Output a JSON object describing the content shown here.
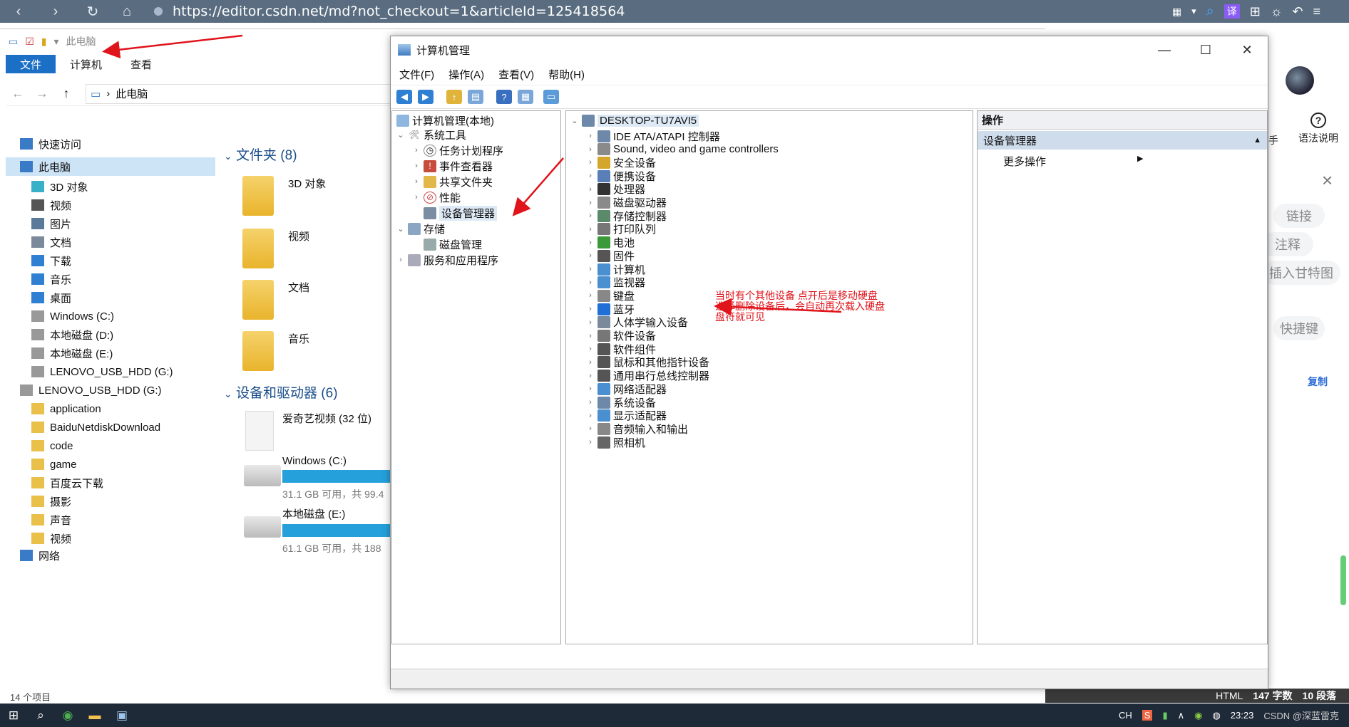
{
  "browser": {
    "url": "https://editor.csdn.net/md?not_checkout=1&articleId=125418564"
  },
  "explorer": {
    "quick_path": "此电脑",
    "tabs": [
      "文件",
      "计算机",
      "查看"
    ],
    "address": "此电脑",
    "nav": [
      {
        "label": "快速访问",
        "icon": "star"
      },
      {
        "label": "此电脑",
        "icon": "pc",
        "selected": true
      },
      {
        "label": "3D 对象",
        "icon": "cube"
      },
      {
        "label": "视频",
        "icon": "film"
      },
      {
        "label": "图片",
        "icon": "picture"
      },
      {
        "label": "文档",
        "icon": "doc"
      },
      {
        "label": "下载",
        "icon": "download"
      },
      {
        "label": "音乐",
        "icon": "music"
      },
      {
        "label": "桌面",
        "icon": "desktop"
      },
      {
        "label": "Windows (C:)",
        "icon": "drive"
      },
      {
        "label": "本地磁盘 (D:)",
        "icon": "drive"
      },
      {
        "label": "本地磁盘 (E:)",
        "icon": "drive"
      },
      {
        "label": "LENOVO_USB_HDD (G:)",
        "icon": "drive"
      },
      {
        "label": "LENOVO_USB_HDD (G:)",
        "icon": "drive"
      },
      {
        "label": "application",
        "icon": "folder"
      },
      {
        "label": "BaiduNetdiskDownload",
        "icon": "folder"
      },
      {
        "label": "code",
        "icon": "folder"
      },
      {
        "label": "game",
        "icon": "folder"
      },
      {
        "label": "百度云下载",
        "icon": "folder"
      },
      {
        "label": "摄影",
        "icon": "folder"
      },
      {
        "label": "声音",
        "icon": "folder"
      },
      {
        "label": "视频",
        "icon": "folder"
      },
      {
        "label": "网络",
        "icon": "network"
      }
    ],
    "folders_header": "文件夹 (8)",
    "folders": [
      "3D 对象",
      "视频",
      "文档",
      "音乐"
    ],
    "drives_header": "设备和驱动器 (6)",
    "drives": [
      {
        "name": "爱奇艺视频 (32 位)",
        "meta": ""
      },
      {
        "name": "Windows (C:)",
        "meta": "31.1 GB 可用，共 99.4"
      },
      {
        "name": "本地磁盘 (E:)",
        "meta": "61.1 GB 可用，共 188"
      }
    ],
    "status": "14 个项目"
  },
  "cm": {
    "title": "计算机管理",
    "menu": [
      "文件(F)",
      "操作(A)",
      "查看(V)",
      "帮助(H)"
    ],
    "tree": {
      "root": "计算机管理(本地)",
      "system_tools": "系统工具",
      "task_scheduler": "任务计划程序",
      "event_viewer": "事件查看器",
      "shared_folders": "共享文件夹",
      "performance": "性能",
      "device_manager": "设备管理器",
      "storage": "存储",
      "disk_management": "磁盘管理",
      "services": "服务和应用程序"
    },
    "computer": "DESKTOP-TU7AVI5",
    "devices": [
      "IDE ATA/ATAPI 控制器",
      "Sound, video and game controllers",
      "安全设备",
      "便携设备",
      "处理器",
      "磁盘驱动器",
      "存储控制器",
      "打印队列",
      "电池",
      "固件",
      "计算机",
      "监视器",
      "键盘",
      "蓝牙",
      "人体学输入设备",
      "软件设备",
      "软件组件",
      "鼠标和其他指针设备",
      "通用串行总线控制器",
      "网络适配器",
      "系统设备",
      "显示适配器",
      "音频输入和输出",
      "照相机"
    ],
    "actions_header": "操作",
    "actions_sub": "设备管理器",
    "actions_more": "更多操作"
  },
  "annotation": {
    "line1": "当时有个其他设备  点开后是移动硬盘",
    "line2": "选择删除设备后，会自动再次载入硬盘",
    "line3": "盘符就可见"
  },
  "csdn": {
    "hand": "手",
    "help": "语法说明",
    "pills": [
      "链接",
      "注释",
      "插入甘特图",
      "快捷键"
    ],
    "copy": "复制",
    "status_format": "HTML",
    "status_words": "147 字数",
    "status_paras": "10 段落"
  },
  "taskbar": {
    "lang": "CH",
    "time": "23:23",
    "watermark": "CSDN @深蓝雷克"
  },
  "colors": {
    "accent": "#1b6fc5",
    "annotation": "#e0141b",
    "selection": "#cde4f7"
  }
}
